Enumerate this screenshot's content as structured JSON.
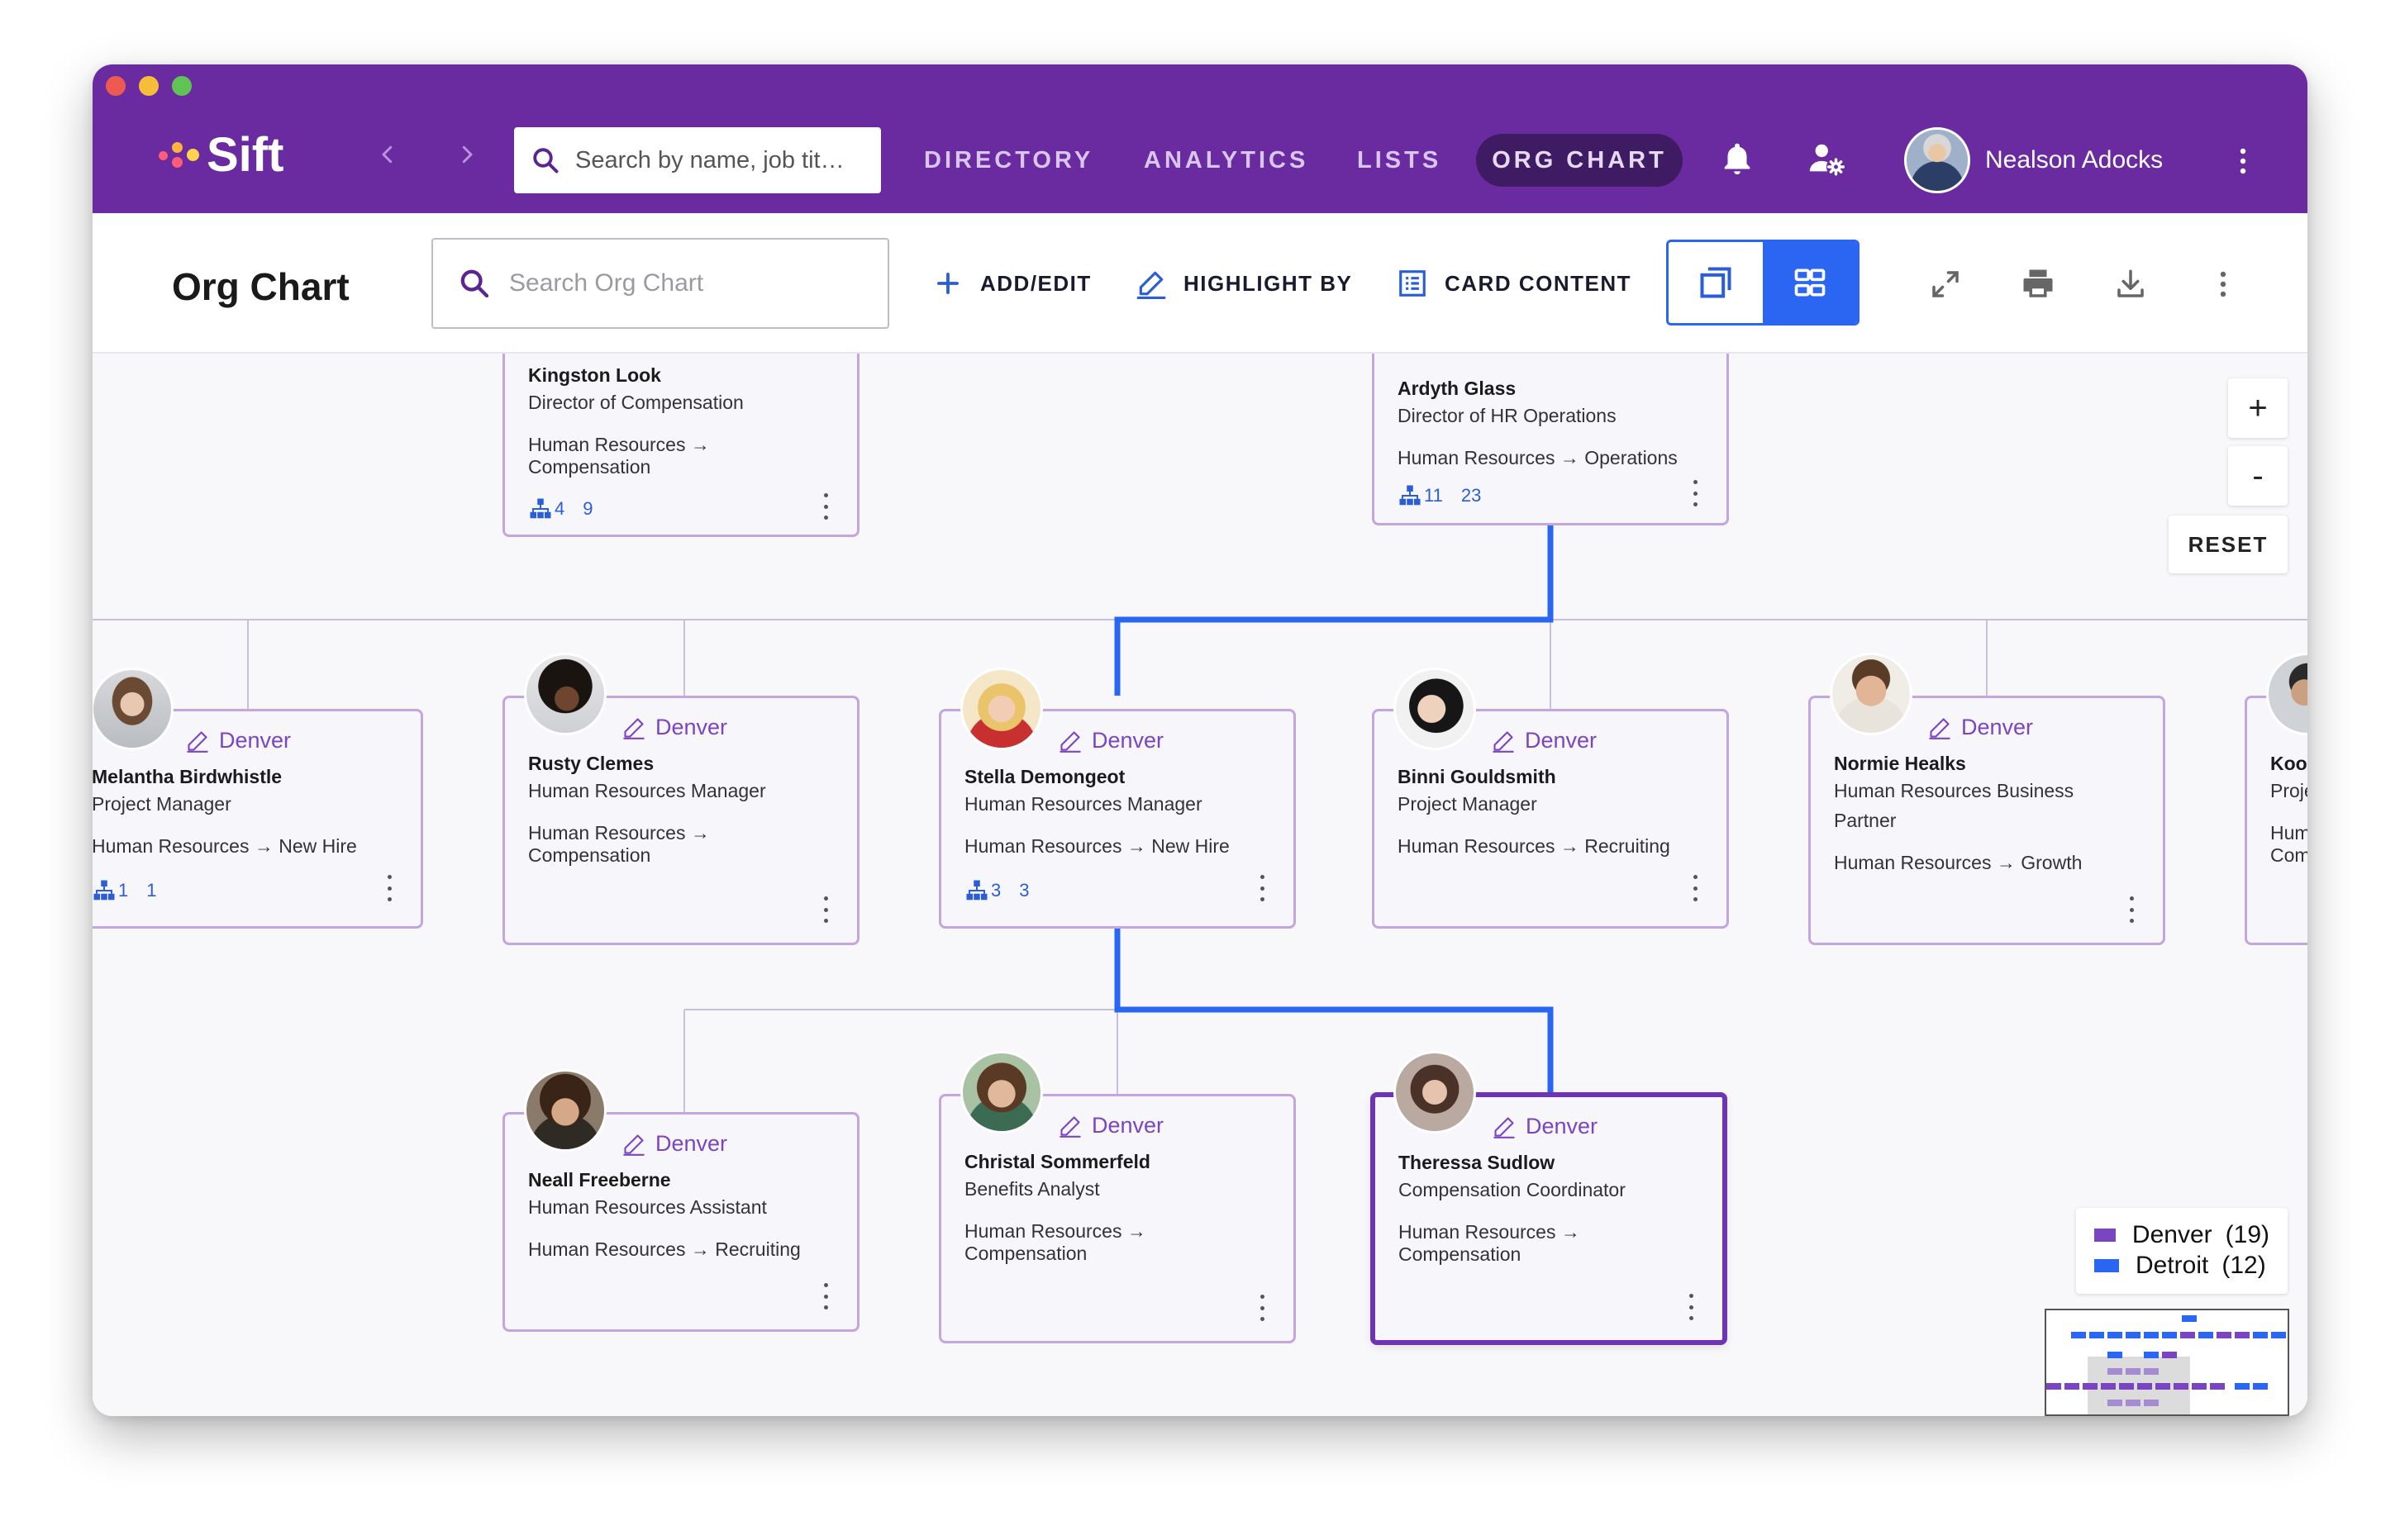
{
  "app": {
    "name": "Sift"
  },
  "nav": {
    "search_placeholder": "Search by name, job tit…",
    "links": [
      "DIRECTORY",
      "ANALYTICS",
      "LISTS"
    ],
    "active": "ORG CHART",
    "user_name": "Nealson Adocks"
  },
  "toolbar": {
    "title": "Org Chart",
    "search_placeholder": "Search Org Chart",
    "add_edit": "ADD/EDIT",
    "highlight_by": "HIGHLIGHT BY",
    "card_content": "CARD CONTENT"
  },
  "colors": {
    "brand": "#6a2ba1",
    "denver": "#7b45c2",
    "detroit": "#2a66f2",
    "highlight_path": "#2a66f2"
  },
  "cards": [
    {
      "name": "Kingston Look",
      "title": "Director of Compensation",
      "dept": "Human Resources → Compensation",
      "location": "",
      "count_a": "4",
      "count_b": "9"
    },
    {
      "name": "Ardyth Glass",
      "title": "Director of HR Operations",
      "dept": "Human Resources → Operations",
      "location": "",
      "count_a": "11",
      "count_b": "23"
    },
    {
      "name": "Melantha Birdwhistle",
      "title": "Project Manager",
      "dept": "Human Resources → New Hire",
      "location": "Denver",
      "count_a": "1",
      "count_b": "1"
    },
    {
      "name": "Rusty Clemes",
      "title": "Human Resources Manager",
      "dept": "Human Resources → Compensation",
      "location": "Denver"
    },
    {
      "name": "Stella Demongeot",
      "title": "Human Resources Manager",
      "dept": "Human Resources → New Hire",
      "location": "Denver",
      "count_a": "3",
      "count_b": "3"
    },
    {
      "name": "Binni Gouldsmith",
      "title": "Project Manager",
      "dept": "Human Resources → Recruiting",
      "location": "Denver"
    },
    {
      "name": "Normie Healks",
      "title": "Human Resources Business Partner",
      "dept": "Human Resources → Growth",
      "location": "Denver"
    },
    {
      "name": "Koo H",
      "title": "Proje",
      "dept": "Huma Comp",
      "location": ""
    },
    {
      "name": "Neall Freeberne",
      "title": "Human Resources Assistant",
      "dept": "Human Resources → Recruiting",
      "location": "Denver"
    },
    {
      "name": "Christal Sommerfeld",
      "title": "Benefits Analyst",
      "dept": "Human Resources → Compensation",
      "location": "Denver"
    },
    {
      "name": "Theressa Sudlow",
      "title": "Compensation Coordinator",
      "dept": "Human Resources → Compensation",
      "location": "Denver"
    }
  ],
  "zoom": {
    "in": "+",
    "out": "-",
    "reset": "RESET"
  },
  "legend": [
    {
      "name": "Denver",
      "count": "(19)",
      "color": "#7b45c2"
    },
    {
      "name": "Detroit",
      "count": "(12)",
      "color": "#2a66f2"
    }
  ]
}
